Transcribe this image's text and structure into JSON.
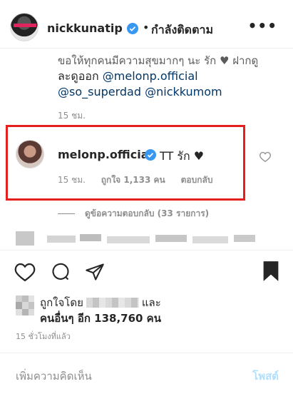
{
  "header": {
    "username": "nickkunatip",
    "separator": "•",
    "follow_status": "กำลังติดตาม",
    "more_label": "•••"
  },
  "comment_prev": {
    "cut_text": "ขอให้ทุกคนมีความสุขมากๆ นะ รัก ♥ ฝากดู",
    "line1": "ละดูออก",
    "mention1": "@melonp.official",
    "mention2": "@so_superdad",
    "mention3": "@nickkumom",
    "time": "15 ชม."
  },
  "comment_main": {
    "username": "melonp.official",
    "text": "TT รัก ♥",
    "time": "15 ชม.",
    "likes": "ถูกใจ 1,133 คน",
    "reply": "ตอบกลับ"
  },
  "view_replies": "ดูข้อความตอบกลับ (33 รายการ)",
  "likes": {
    "prefix": "ถูกใจโดย",
    "suffix": "และ",
    "others": "คนอื่นๆ อีก 138,760 คน"
  },
  "time_ago": "15 ชั่วโมงที่แล้ว",
  "comment_box": {
    "placeholder": "เพิ่มความคิดเห็น",
    "post_label": "โพสต์"
  },
  "colors": {
    "highlight": "#e3201b",
    "verified": "#3897f0",
    "mention": "#00376b",
    "post_disabled": "#b2dffc"
  }
}
